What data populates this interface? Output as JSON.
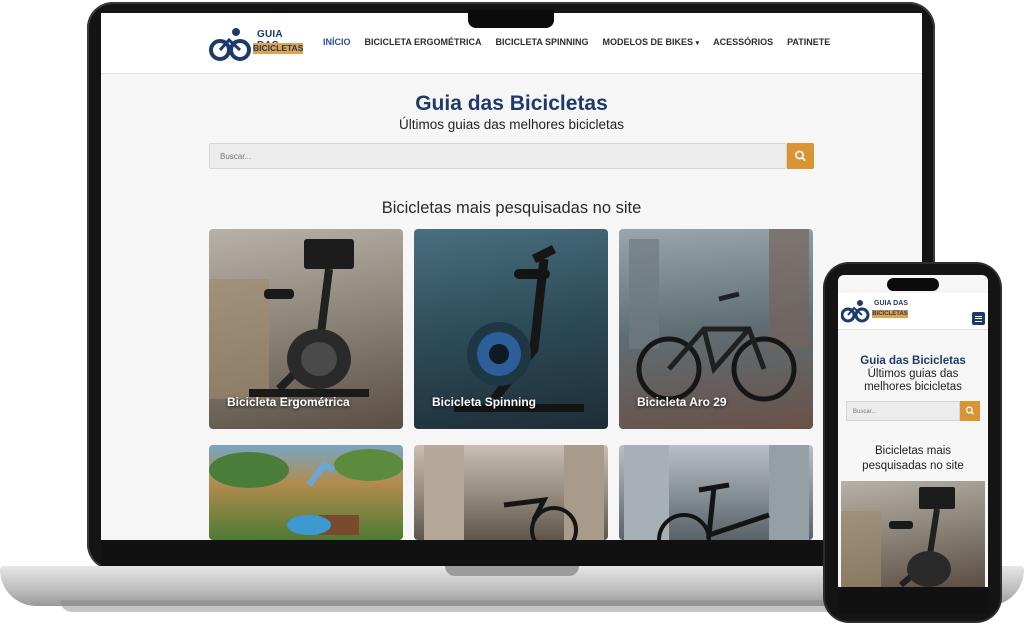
{
  "desktop": {
    "logo": {
      "line1": "GUIA DAS",
      "line2": "BICICLETAS"
    },
    "nav": [
      {
        "label": "INÍCIO",
        "active": true
      },
      {
        "label": "BICICLETA ERGOMÉTRICA"
      },
      {
        "label": "BICICLETA SPINNING"
      },
      {
        "label": "MODELOS DE BIKES"
      },
      {
        "label": "ACESSÓRIOS"
      },
      {
        "label": "PATINETE"
      }
    ],
    "hero": {
      "title": "Guia das Bicicletas",
      "subtitle": "Últimos guias das melhores bicicletas"
    },
    "search": {
      "placeholder": "Buscar..."
    },
    "section_title": "Bicicletas mais pesquisadas no site",
    "cards": [
      {
        "label": "Bicicleta Ergométrica"
      },
      {
        "label": "Bicicleta Spinning"
      },
      {
        "label": "Bicicleta Aro 29"
      }
    ]
  },
  "mobile": {
    "logo": {
      "line1": "GUIA DAS",
      "line2": "BICICLETAS"
    },
    "hero": {
      "title": "Guia das Bicicletas",
      "subtitle": "Últimos guias das melhores bicicletas"
    },
    "search": {
      "placeholder": "Buscar..."
    },
    "section_title": "Bicicletas mais pesquisadas no site"
  },
  "colors": {
    "brand_blue": "#1d3a6b",
    "accent_orange": "#d99433",
    "nav_active": "#2a4fa0"
  },
  "icons": [
    "cyclist-logo-icon",
    "chevron-down-icon",
    "search-icon",
    "hamburger-menu-icon"
  ]
}
